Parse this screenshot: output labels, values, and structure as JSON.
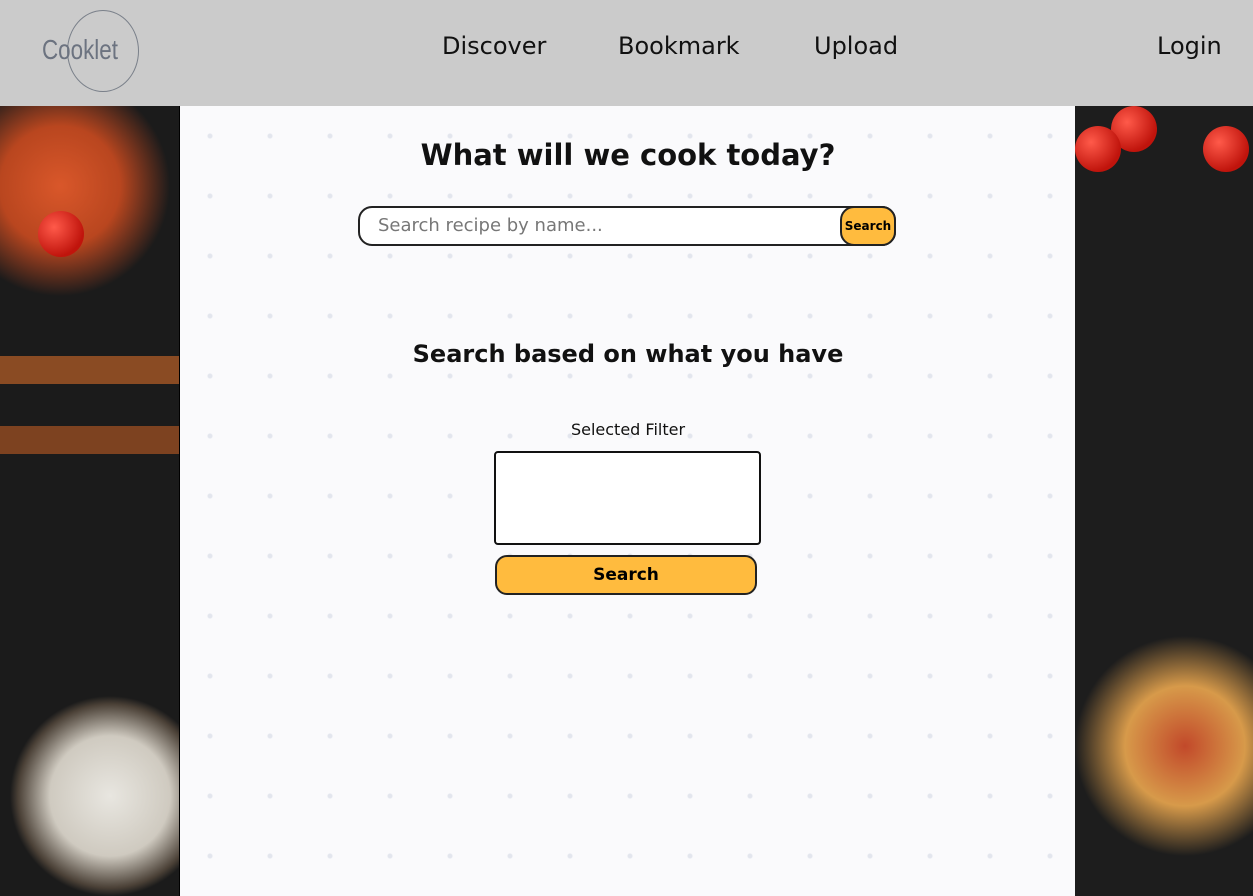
{
  "nav": {
    "logo": "Cooklet",
    "links": [
      "Discover",
      "Bookmark",
      "Upload"
    ],
    "login": "Login"
  },
  "main": {
    "title": "What will we cook today?",
    "search": {
      "placeholder": "Search recipe by name...",
      "value": "",
      "button": "Search"
    },
    "subtitle": "Search based on what you have",
    "filter_label": "Selected Filter",
    "filter_button": "Search"
  },
  "colors": {
    "accent": "#ffbb3e",
    "nav_bg": "#cbcbcb"
  }
}
